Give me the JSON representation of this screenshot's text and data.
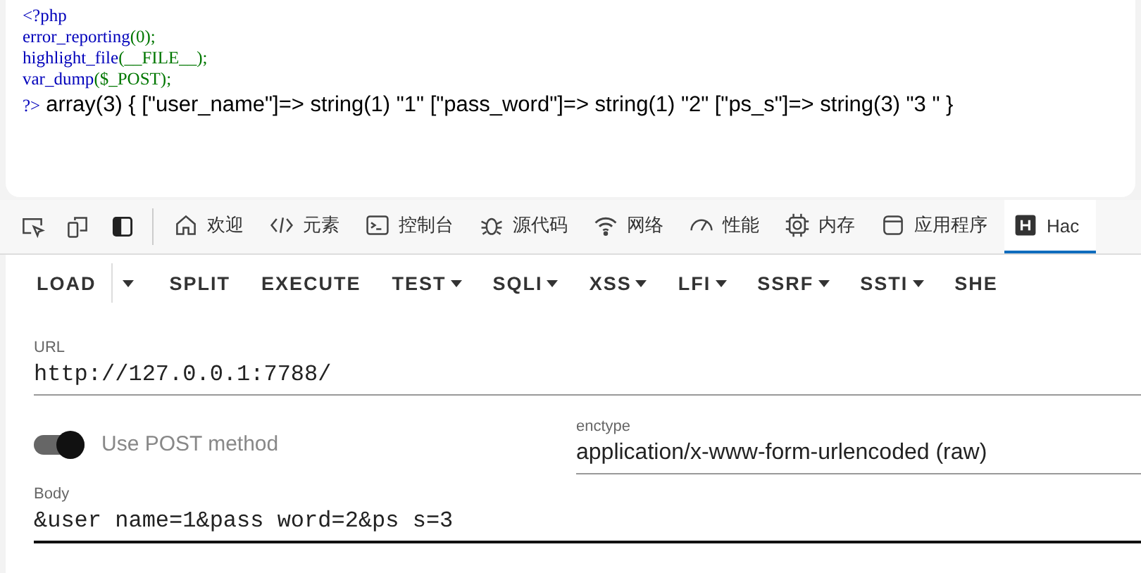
{
  "source": {
    "lines": [
      [
        {
          "kind": "default",
          "text": "<?php"
        }
      ],
      [
        {
          "kind": "default",
          "text": "error_reporting"
        },
        {
          "kind": "punct",
          "text": "(0);"
        }
      ],
      [
        {
          "kind": "default",
          "text": "highlight_file"
        },
        {
          "kind": "punct",
          "text": "(__FILE__);"
        }
      ],
      [
        {
          "kind": "default",
          "text": "var_dump"
        },
        {
          "kind": "punct",
          "text": "($_POST);"
        }
      ]
    ],
    "closing": "?>",
    "output": "array(3) { [\"user_name\"]=> string(1) \"1\" [\"pass_word\"]=> string(1) \"2\" [\"ps_s\"]=> string(3) \"3 \" }"
  },
  "devtools": {
    "tabs": [
      {
        "kind": "welcome",
        "label": "欢迎",
        "selected": false
      },
      {
        "kind": "elements",
        "label": "元素",
        "selected": false
      },
      {
        "kind": "console",
        "label": "控制台",
        "selected": false
      },
      {
        "kind": "sources",
        "label": "源代码",
        "selected": false
      },
      {
        "kind": "network",
        "label": "网络",
        "selected": false
      },
      {
        "kind": "performance",
        "label": "性能",
        "selected": false
      },
      {
        "kind": "memory",
        "label": "内存",
        "selected": false
      },
      {
        "kind": "application",
        "label": "应用程序",
        "selected": false
      },
      {
        "kind": "hackbar",
        "label": "Hac",
        "selected": true
      }
    ]
  },
  "hackbar": {
    "menu": [
      {
        "label": "LOAD",
        "dropdown": false
      },
      {
        "label": "SPLIT",
        "dropdown": false
      },
      {
        "label": "EXECUTE",
        "dropdown": false
      },
      {
        "label": "TEST",
        "dropdown": true
      },
      {
        "label": "SQLI",
        "dropdown": true
      },
      {
        "label": "XSS",
        "dropdown": true
      },
      {
        "label": "LFI",
        "dropdown": true
      },
      {
        "label": "SSRF",
        "dropdown": true
      },
      {
        "label": "SSTI",
        "dropdown": true
      },
      {
        "label": "SHE",
        "dropdown": false
      }
    ],
    "url": {
      "label": "URL",
      "value": "http://127.0.0.1:7788/"
    },
    "post": {
      "label": "Use POST method",
      "on": true
    },
    "enctype": {
      "label": "enctype",
      "value": "application/x-www-form-urlencoded (raw)"
    },
    "body": {
      "label": "Body",
      "value": "&user name=1&pass word=2&ps s=3"
    }
  }
}
